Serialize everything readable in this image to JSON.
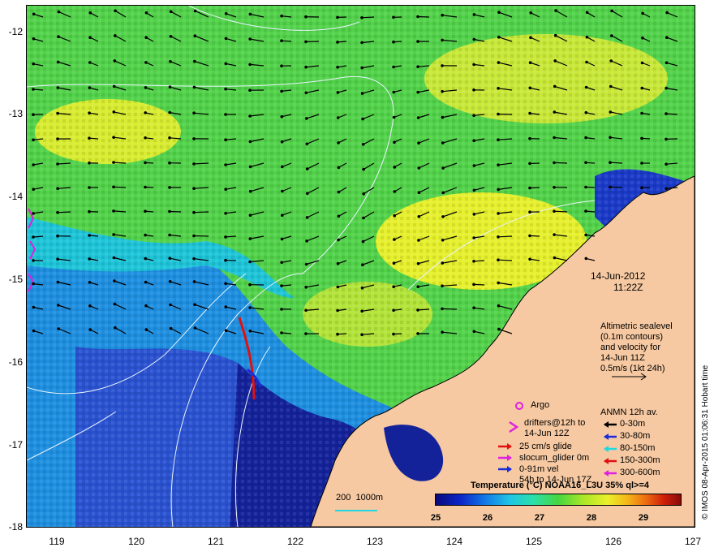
{
  "map": {
    "y_ticks": [
      "-12",
      "-13",
      "-14",
      "-15",
      "-16",
      "-17",
      "-18"
    ],
    "x_ticks": [
      "119",
      "120",
      "121",
      "122",
      "123",
      "124",
      "125",
      "126",
      "127"
    ],
    "lat_range": [
      -18,
      -11.8
    ],
    "lon_range": [
      118.6,
      127
    ]
  },
  "annotations": {
    "date": "14-Jun-2012",
    "time": "11:22Z",
    "sealevel_lines": [
      "Altimetric sealevel",
      "(0.1m contours)",
      "and velocity for",
      "14-Jun 11Z",
      "0.5m/s (1kt 24h)"
    ],
    "credit": "© IMOS 08-Apr-2015 01:06:31 Hobart time",
    "scale_label": "200  1000m"
  },
  "legend": {
    "argo": "Argo",
    "drifters": "drifters@12h to",
    "drifters_date": "14-Jun 12Z",
    "glide": "25 cm/s glide",
    "slocum": "slocum_glider 0m",
    "vel": "0-91m vel",
    "vel_date": "54h to 14-Jun 17Z",
    "anmn_title": "ANMN 12h av.",
    "anmn_items": [
      {
        "label": "0-30m",
        "color": "#000000"
      },
      {
        "label": "30-80m",
        "color": "#1a2bd8"
      },
      {
        "label": "80-150m",
        "color": "#20d8e0"
      },
      {
        "label": "150-300m",
        "color": "#e01010"
      },
      {
        "label": "300-600m",
        "color": "#e020e0"
      }
    ],
    "colors": {
      "argo": "#e020e0",
      "drifters": "#e020e0",
      "glide": "#e01010",
      "slocum": "#e020e0",
      "vel": "#1a2bd8"
    }
  },
  "colorbar": {
    "title": "Temperature (°C) NOAA16_L3U 35% ql>=4",
    "ticks": [
      "25",
      "26",
      "27",
      "28",
      "29"
    ],
    "range": [
      25,
      29.7
    ]
  },
  "colors": {
    "land": "#f6c9a2",
    "contour": "#e8f4ff",
    "arrow": "#000000"
  }
}
